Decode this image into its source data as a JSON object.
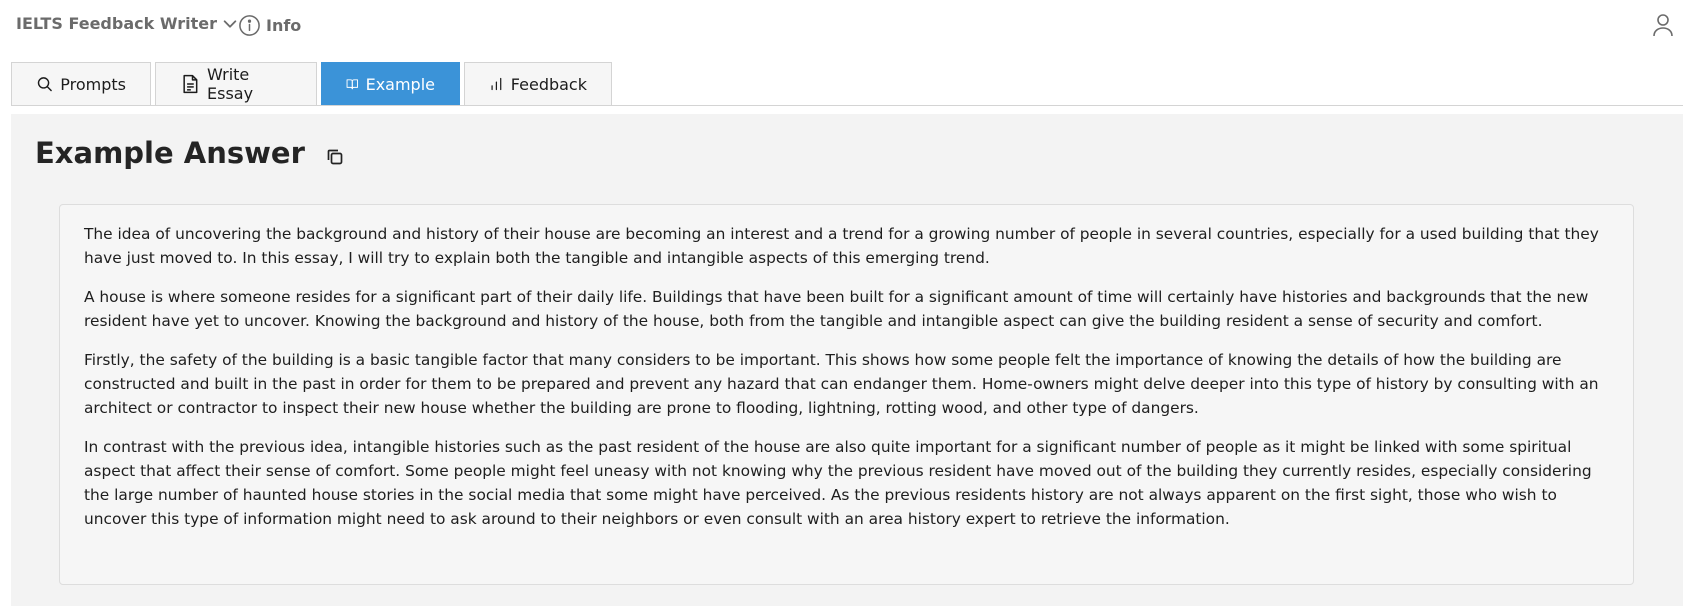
{
  "app": {
    "title": "IELTS Feedback Writer",
    "info_label": "Info"
  },
  "tabs": [
    {
      "label": "Prompts",
      "icon": "search-icon",
      "active": false
    },
    {
      "label": "Write Essay",
      "icon": "document-icon",
      "active": false
    },
    {
      "label": "Example",
      "icon": "open-book-icon",
      "active": true
    },
    {
      "label": "Feedback",
      "icon": "bar-chart-icon",
      "active": false
    }
  ],
  "colors": {
    "accent": "#3b93d8",
    "panel_bg": "#f3f3f3",
    "muted_text": "#6b6b6b"
  },
  "example": {
    "heading": "Example Answer",
    "paragraphs": [
      "The idea of uncovering the background and history of their house are becoming an interest and a trend for a growing number of people in several countries, especially for a used building that they have just moved to. In this essay, I will try to explain both the tangible and intangible aspects of this emerging trend.",
      "A house is where someone resides for a significant part of their daily life. Buildings that have been built for a significant amount of time will certainly have histories and backgrounds that the new resident have yet to uncover. Knowing the background and history of the house, both from the tangible and intangible aspect can give the building resident a sense of security and comfort.",
      "Firstly, the safety of the building is a basic tangible factor that many considers to be important. This shows how some people felt the importance of knowing the details of how the building are constructed and built in the past in order for them to be prepared and prevent any hazard that can endanger them. Home-owners might delve deeper into this type of history by consulting with an architect or contractor to inspect their new house whether the building are prone to flooding, lightning, rotting wood, and other type of dangers.",
      "In contrast with the previous idea, intangible histories such as the past resident of the house are also quite important for a significant number of people as it might be linked with some spiritual aspect that affect their sense of comfort. Some people might feel uneasy with not knowing why the previous resident have moved out of the building they currently resides, especially considering the large number of haunted house stories in the social media that some might have perceived. As the previous residents history are not always apparent on the first sight, those who wish to uncover this type of information might need to ask around to their neighbors or even consult with an area history expert to retrieve the information."
    ]
  }
}
